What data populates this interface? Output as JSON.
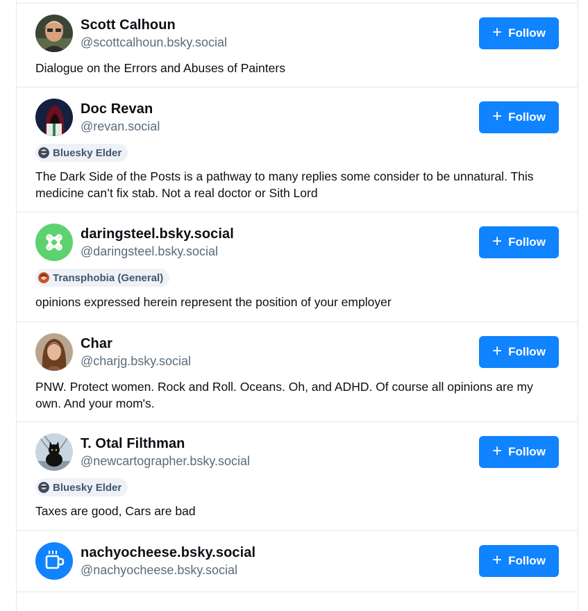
{
  "follow_label": "Follow",
  "users": [
    {
      "name": "Scott Calhoun",
      "handle": "@scottcalhoun.bsky.social",
      "bio": "Dialogue on the Errors and Abuses of Painters",
      "avatar": "portrait-photo-avatar"
    },
    {
      "name": "Doc Revan",
      "handle": "@revan.social",
      "badge": "Bluesky Elder",
      "bio": "The Dark Side of the Posts is a pathway to many replies some consider to be unnatural. This medicine can’t fix stab. Not a real doctor or Sith Lord",
      "avatar": "hooded-figure-avatar"
    },
    {
      "name": "daringsteel.bsky.social",
      "handle": "@daringsteel.bsky.social",
      "badge": "Transphobia (General)",
      "bio": "opinions expressed herein represent the position of your employer",
      "avatar": "green-knot-avatar"
    },
    {
      "name": "Char",
      "handle": "@charjg.bsky.social",
      "bio": "PNW. Protect women. Rock and Roll. Oceans. Oh, and ADHD.  Of course all opinions are my own. And your mom's.",
      "avatar": "woman-portrait-avatar"
    },
    {
      "name": "T. Otal Filthman",
      "handle": "@newcartographer.bsky.social",
      "badge": "Bluesky Elder",
      "bio": "Taxes are good, Cars are bad",
      "avatar": "black-cat-avatar"
    },
    {
      "name": "nachyocheese.bsky.social",
      "handle": "@nachyocheese.bsky.social",
      "avatar": "coffee-cup-avatar"
    }
  ],
  "colors": {
    "follow_button": "#1083fe",
    "handle_text": "#5a6b7d",
    "badge_bg": "#eef1f5",
    "badge_text": "#42576c",
    "divider": "#e2e7ee"
  }
}
